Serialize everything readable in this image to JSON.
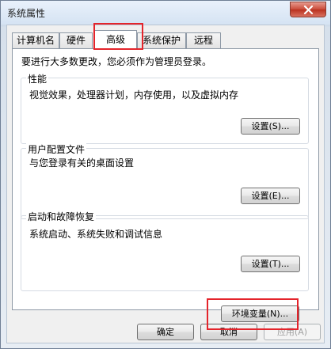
{
  "window": {
    "title": "系统属性"
  },
  "tabs": [
    {
      "label": "计算机名",
      "active": false
    },
    {
      "label": "硬件",
      "active": false
    },
    {
      "label": "高级",
      "active": true
    },
    {
      "label": "系统保护",
      "active": false
    },
    {
      "label": "远程",
      "active": false
    }
  ],
  "advanced": {
    "notice": "要进行大多数更改，您必须作为管理员登录。",
    "performance": {
      "title": "性能",
      "description": "视觉效果，处理器计划，内存使用，以及虚拟内存",
      "button": "设置(S)..."
    },
    "user_profiles": {
      "title": "用户配置文件",
      "description": "与您登录有关的桌面设置",
      "button": "设置(E)..."
    },
    "startup_recovery": {
      "title": "启动和故障恢复",
      "description": "系统启动、系统失败和调试信息",
      "button": "设置(T)..."
    },
    "env_button": "环境变量(N)..."
  },
  "footer": {
    "ok": "确定",
    "cancel": "取消",
    "apply": "应用(A)"
  },
  "colors": {
    "highlight": "#e4242b",
    "close_button": "#c94a37"
  }
}
